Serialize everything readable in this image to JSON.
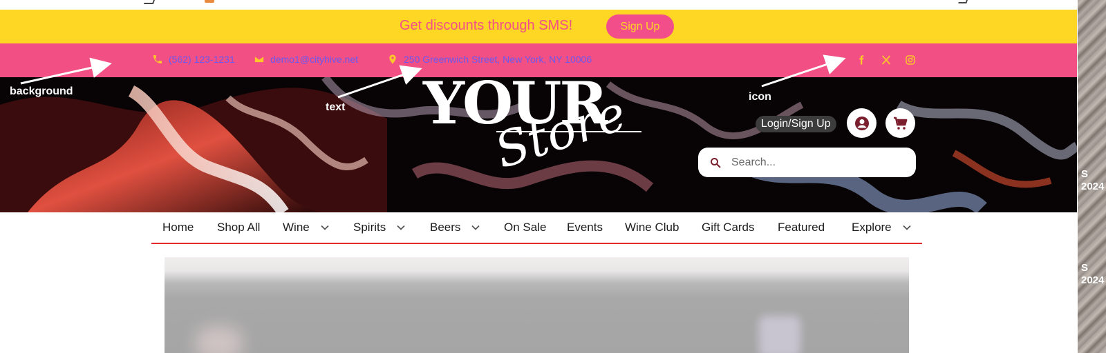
{
  "sms_bar": {
    "message": "Get discounts through SMS!",
    "signup_label": "Sign Up"
  },
  "contact": {
    "phone": "(562) 123-1231",
    "email": "demo1@cityhive.net",
    "address": "250 Greenwich Street, New York, NY 10006"
  },
  "social": [
    "facebook-icon",
    "x-icon",
    "instagram-icon"
  ],
  "logo": {
    "line1": "YOUR",
    "line2": "Store"
  },
  "header": {
    "login_label": "Login/Sign Up",
    "search_placeholder": "Search..."
  },
  "nav": {
    "items": [
      {
        "label": "Home",
        "dropdown": false
      },
      {
        "label": "Shop All",
        "dropdown": false
      },
      {
        "label": "Wine",
        "dropdown": true
      },
      {
        "label": "Spirits",
        "dropdown": true
      },
      {
        "label": "Beers",
        "dropdown": true
      },
      {
        "label": "On Sale",
        "dropdown": false
      },
      {
        "label": "Events",
        "dropdown": false
      },
      {
        "label": "Wine Club",
        "dropdown": false
      },
      {
        "label": "Gift Cards",
        "dropdown": false
      },
      {
        "label": "Featured",
        "dropdown": false
      },
      {
        "label": "Explore",
        "dropdown": true
      }
    ]
  },
  "annotations": {
    "background": "background",
    "text": "text",
    "icon": "icon"
  },
  "side_collage": {
    "text1_line1": "S",
    "text1_line2": "2024",
    "text2_line1": "S",
    "text2_line2": "2024"
  },
  "colors": {
    "sms_bar": "#fed624",
    "contact_bar": "#f24f84",
    "accent_pink": "#f24f8a",
    "nav_underline": "#e22a2a",
    "contact_text": "#6b58ee",
    "icon_yellow": "#ffc729"
  }
}
